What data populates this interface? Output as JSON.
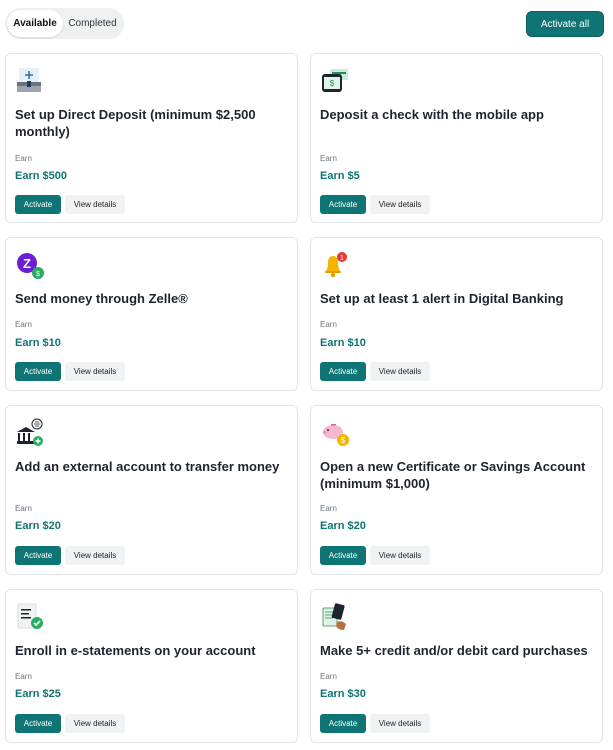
{
  "tabs": {
    "available": "Available",
    "completed": "Completed"
  },
  "activate_all": "Activate all",
  "offers": [
    {
      "title": "Set up Direct Deposit (minimum $2,500 monthly)",
      "earn_label": "Earn",
      "earn_amount": "Earn $500",
      "activate": "Activate",
      "details": "View details",
      "icon": "direct-deposit-icon"
    },
    {
      "title": "Deposit a check with the mobile app",
      "earn_label": "Earn",
      "earn_amount": "Earn $5",
      "activate": "Activate",
      "details": "View details",
      "icon": "mobile-check-icon"
    },
    {
      "title": "Send money through Zelle®",
      "earn_label": "Earn",
      "earn_amount": "Earn $10",
      "activate": "Activate",
      "details": "View details",
      "icon": "zelle-icon"
    },
    {
      "title": "Set up at least 1 alert in Digital Banking",
      "earn_label": "Earn",
      "earn_amount": "Earn $10",
      "activate": "Activate",
      "details": "View details",
      "icon": "bell-icon",
      "badge": "1"
    },
    {
      "title": "Add an external account to transfer money",
      "earn_label": "Earn",
      "earn_amount": "Earn $20",
      "activate": "Activate",
      "details": "View details",
      "icon": "bank-transfer-icon"
    },
    {
      "title": "Open a new Certificate or Savings Account (minimum $1,000)",
      "earn_label": "Earn",
      "earn_amount": "Earn $20",
      "activate": "Activate",
      "details": "View details",
      "icon": "piggy-bank-icon"
    },
    {
      "title": "Enroll in e-statements on your account",
      "earn_label": "Earn",
      "earn_amount": "Earn $25",
      "activate": "Activate",
      "details": "View details",
      "icon": "e-statement-icon"
    },
    {
      "title": "Make 5+ credit and/or debit card purchases",
      "earn_label": "Earn",
      "earn_amount": "Earn $30",
      "activate": "Activate",
      "details": "View details",
      "icon": "card-purchase-icon"
    }
  ],
  "colors": {
    "accent": "#0f7474",
    "border": "#e1e4e8"
  }
}
